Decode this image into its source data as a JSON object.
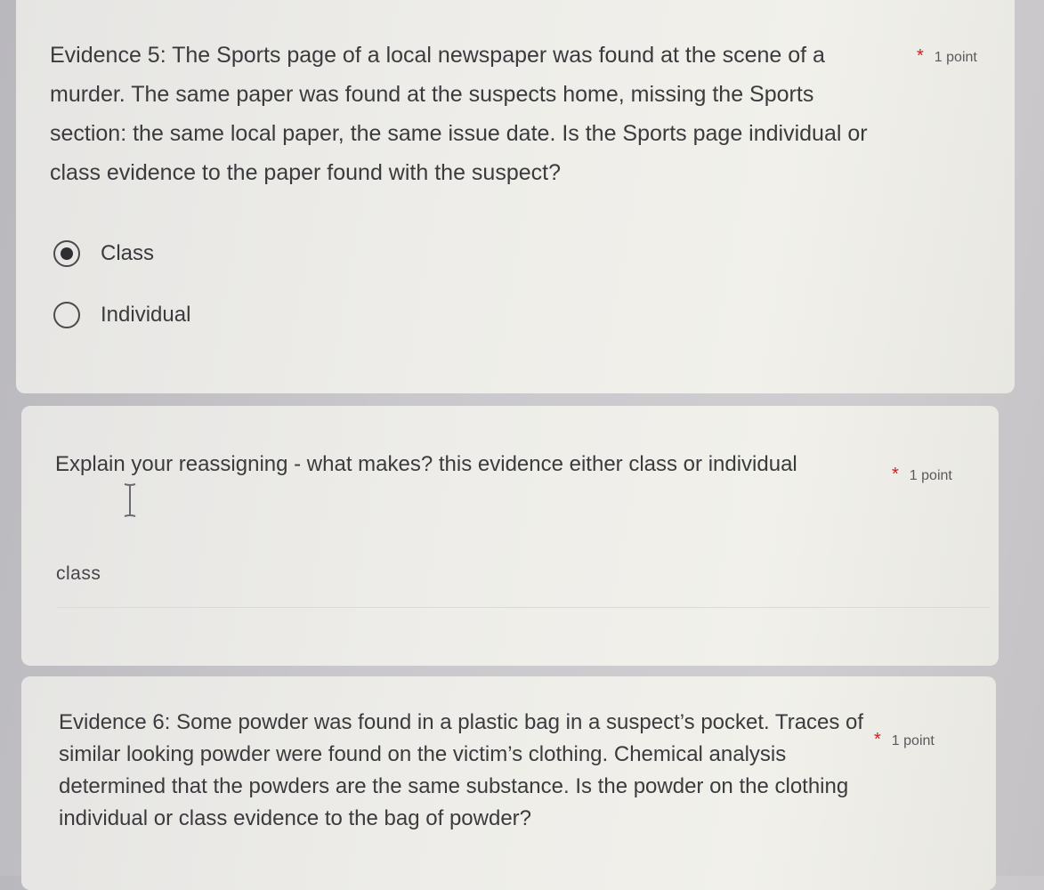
{
  "questions": [
    {
      "text": "Evidence 5: The Sports page of a local newspaper was found at the scene of a murder. The same paper was found at the suspects home, missing the Sports section:  the same local paper, the same issue date. Is the Sports page individual or class evidence to the paper found with the suspect?",
      "required_mark": "*",
      "points": "1 point",
      "options": [
        {
          "label": "Class",
          "selected": true
        },
        {
          "label": "Individual",
          "selected": false
        }
      ]
    },
    {
      "text": "Explain your reassigning - what makes? this evidence either class or individual",
      "required_mark": "*",
      "points": "1 point",
      "answer": "class"
    },
    {
      "text": "Evidence 6: Some powder was found in a plastic bag in a suspect’s pocket. Traces of similar looking powder were found on the victim’s clothing. Chemical analysis determined that the powders are the same substance. Is the powder on the clothing individual or class evidence to the bag of powder?",
      "required_mark": "*",
      "points": "1 point"
    }
  ],
  "colors": {
    "required_star": "#c5221f",
    "card_background": "#eeede9",
    "page_background": "#c9c8cc"
  },
  "icons": {
    "text_cursor": "i-beam-cursor-icon"
  }
}
